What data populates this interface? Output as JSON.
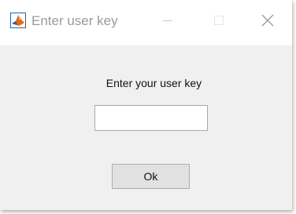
{
  "window": {
    "title": "Enter user key",
    "app_icon": "matlab-membrane-icon",
    "controls": {
      "minimize_icon": "minimize-icon",
      "maximize_icon": "maximize-icon",
      "close_icon": "close-icon"
    }
  },
  "dialog": {
    "prompt": "Enter your user key",
    "input": {
      "value": "",
      "placeholder": ""
    },
    "ok_label": "Ok"
  },
  "colors": {
    "titlebar_bg": "#ffffff",
    "title_text": "#9a9a9a",
    "client_bg": "#f0f0f0",
    "button_bg": "#e1e1e1",
    "button_border": "#adadad",
    "input_border": "#a8a8a8",
    "icon_orange": "#e2661c",
    "icon_blue": "#2a5ea8"
  }
}
